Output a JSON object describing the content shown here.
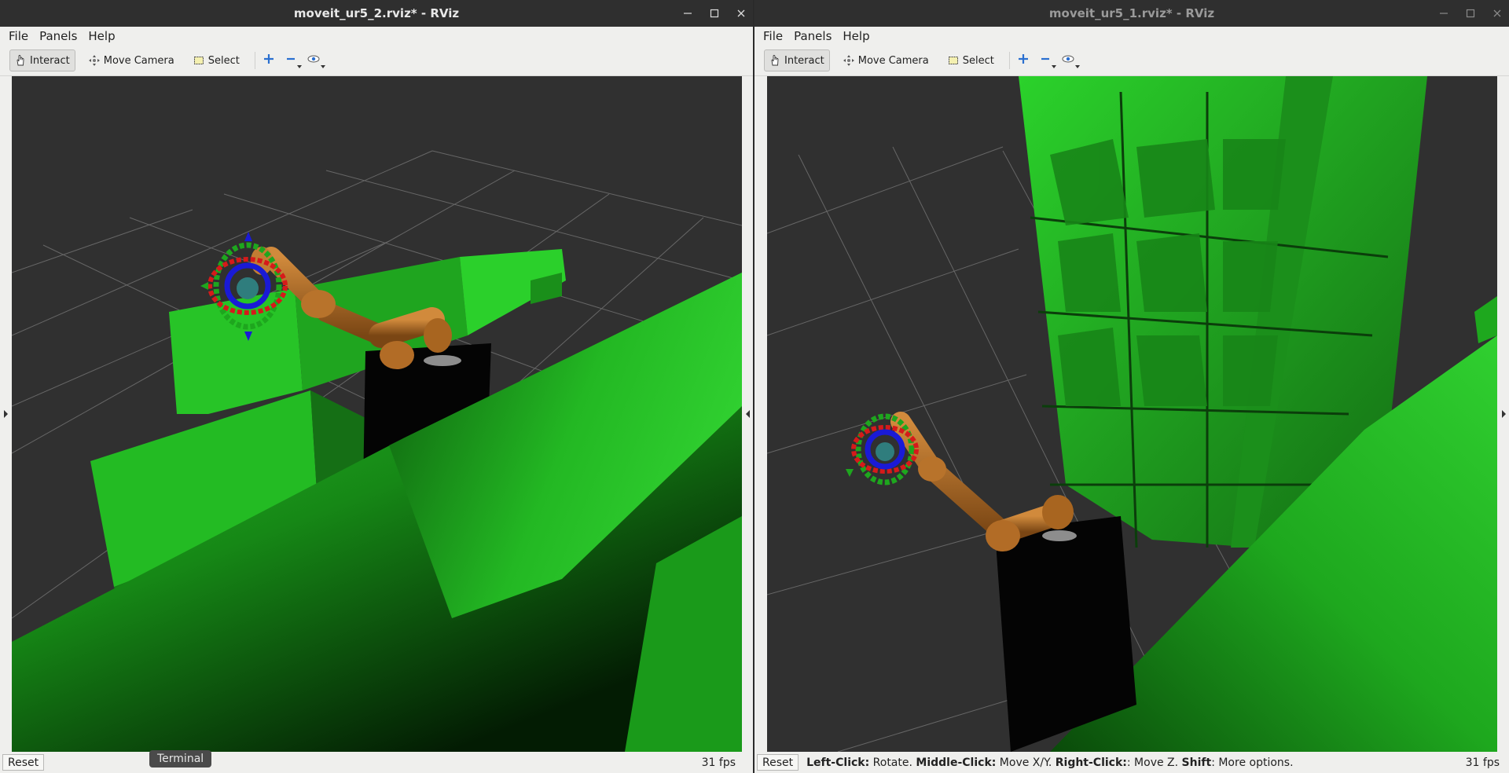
{
  "windows": {
    "left": {
      "title": "moveit_ur5_2.rviz* - RViz",
      "status_text": "",
      "fps": "31 fps"
    },
    "right": {
      "title": "moveit_ur5_1.rviz* - RViz",
      "status_parts": [
        {
          "bold": "Left-Click:",
          "text": " Rotate. "
        },
        {
          "bold": "Middle-Click:",
          "text": " Move X/Y. "
        },
        {
          "bold": "Right-Click:",
          "text": ": Move Z. "
        },
        {
          "bold": "Shift",
          "text": ": More options."
        }
      ],
      "fps": "31 fps"
    }
  },
  "menu": {
    "file": "File",
    "panels": "Panels",
    "help": "Help"
  },
  "toolbar": {
    "interact": "Interact",
    "move_camera": "Move Camera",
    "select": "Select",
    "icons": [
      "hand-icon",
      "camera-move-icon",
      "select-box-icon",
      "add-tool-icon",
      "remove-tool-icon",
      "eye-icon"
    ]
  },
  "statusbar": {
    "reset": "Reset"
  },
  "taskbar": {
    "terminal_tooltip": "Terminal"
  },
  "colors": {
    "titlebar": "#2f2f2f",
    "viewport_bg": "#303030",
    "grid": "#6a6a6a",
    "collision_green": "#27c427",
    "robot_orange": "#b8732b",
    "pedestal": "#050505"
  }
}
